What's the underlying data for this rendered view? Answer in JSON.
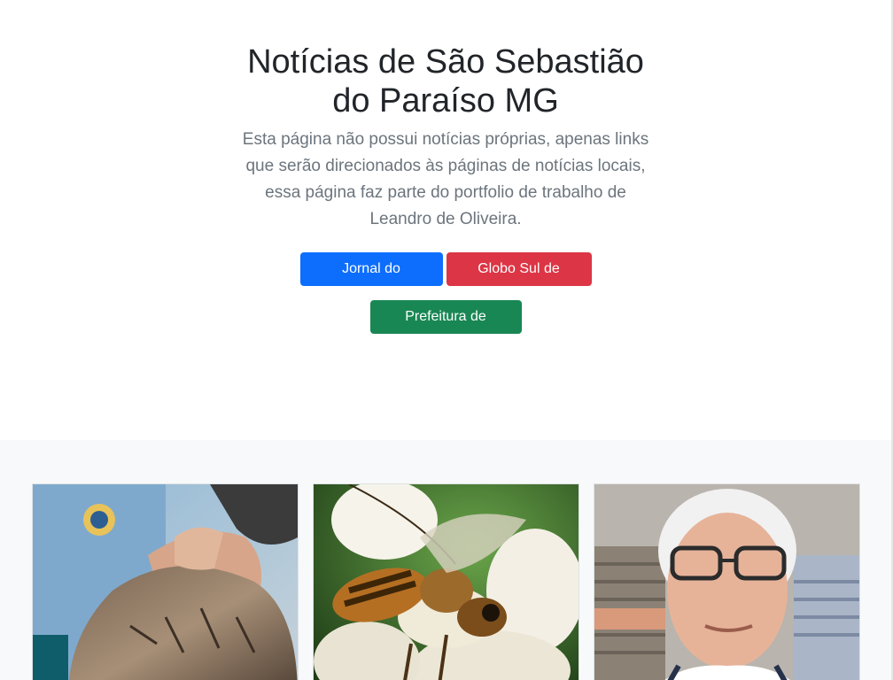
{
  "hero": {
    "title": "Notícias de São Sebastião do Paraíso MG",
    "lead": "Esta página não possui notícias próprias, apenas links que serão direcionados às páginas de notícias locais, essa página faz parte do portfolio de trabalho de Leandro de Oliveira."
  },
  "buttons": {
    "jornal": "Jornal do Sudoeste",
    "globo": "Globo Sul de Minas",
    "prefeitura": "Prefeitura de Paraíso"
  },
  "colors": {
    "primary": "#0d6efd",
    "danger": "#dc3545",
    "success": "#198754",
    "muted": "#6c757d",
    "album_bg": "#f8f9fa"
  },
  "cards": [
    {
      "image": "dog-being-examined-photo"
    },
    {
      "image": "bee-on-white-flower-photo"
    },
    {
      "image": "elderly-man-with-glasses-photo"
    }
  ]
}
